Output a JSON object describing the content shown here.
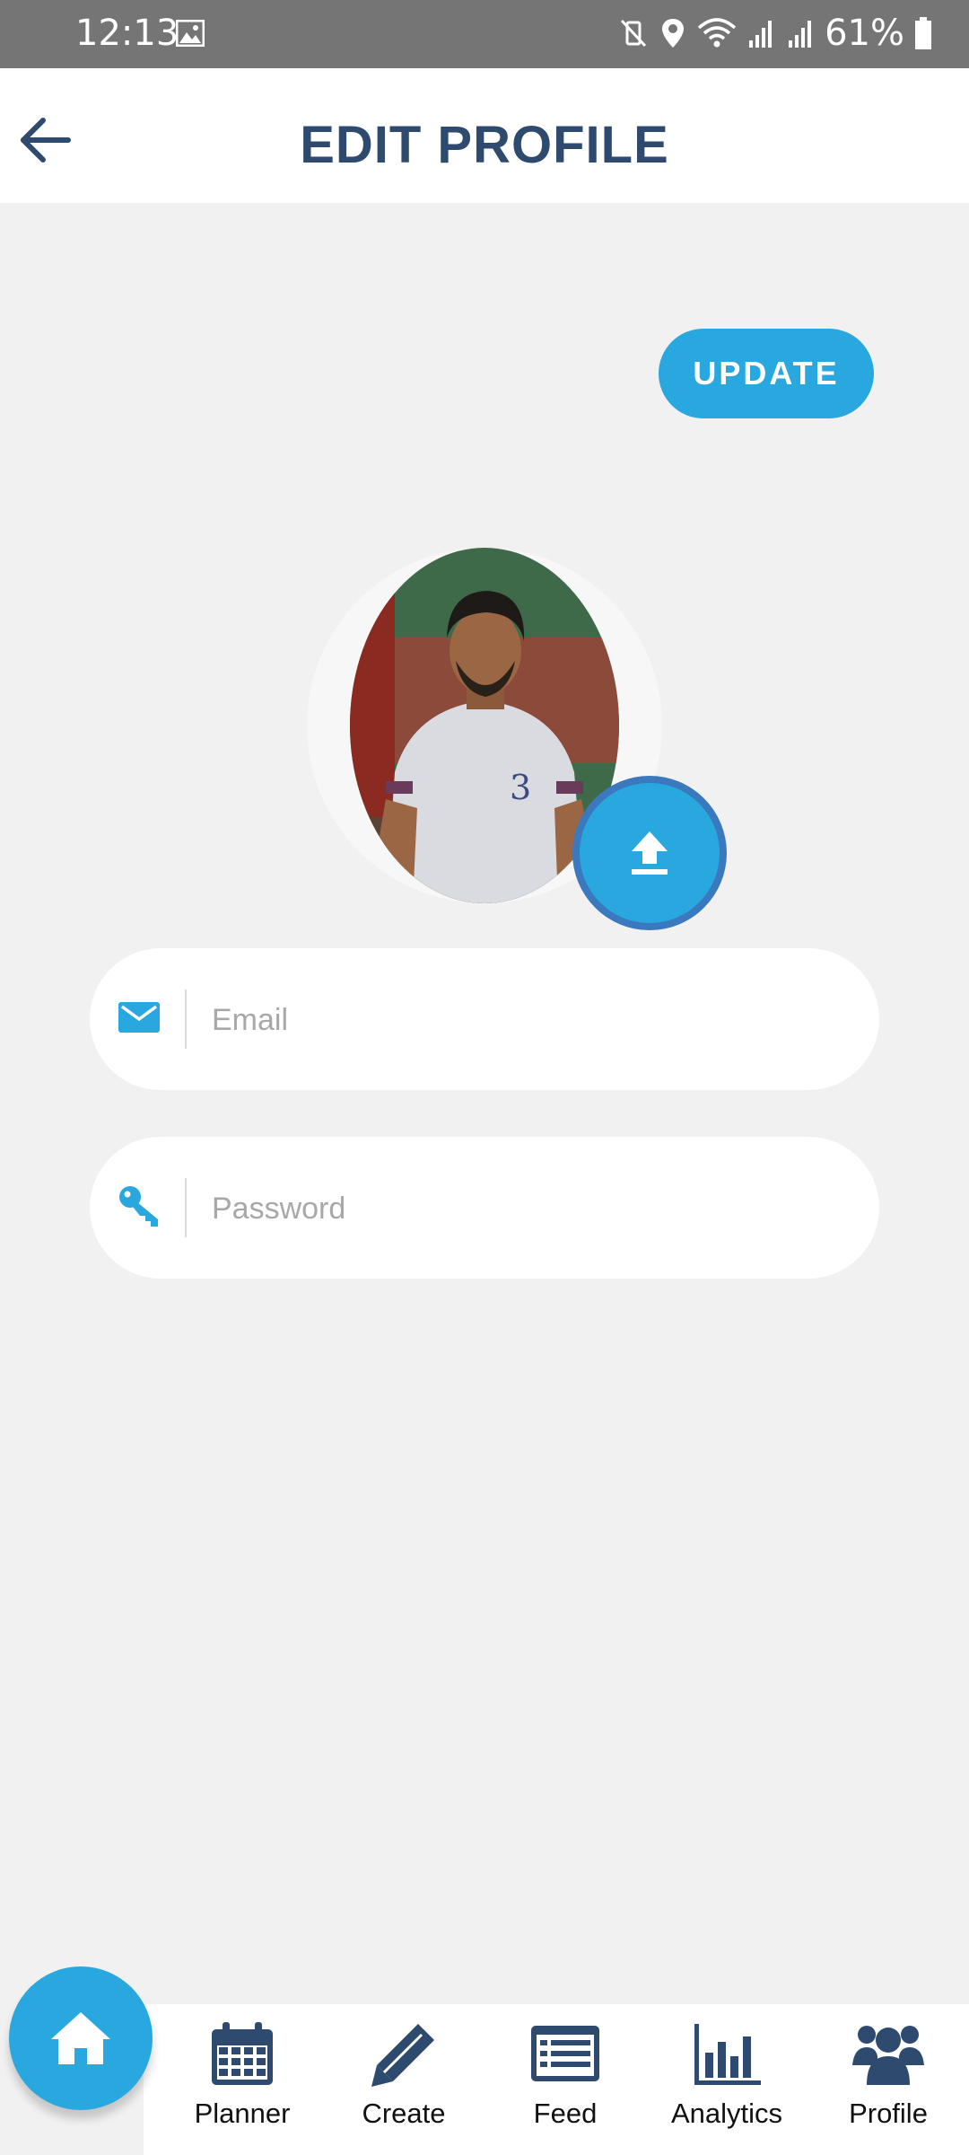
{
  "status_bar": {
    "time": "12:13",
    "battery": "61%",
    "icons": [
      "gallery-icon",
      "mute-vibrate-icon",
      "location-icon",
      "wifi-icon",
      "signal-icon",
      "signal-icon",
      "battery-icon"
    ]
  },
  "header": {
    "title": "EDIT PROFILE",
    "back_icon": "arrow-left-icon"
  },
  "actions": {
    "update_label": "UPDATE"
  },
  "avatar": {
    "upload_icon": "upload-icon"
  },
  "form": {
    "email": {
      "placeholder": "Email",
      "value": "",
      "icon": "mail-icon"
    },
    "password": {
      "placeholder": "Password",
      "value": "",
      "icon": "key-icon"
    }
  },
  "bottom_nav": {
    "home_icon": "home-icon",
    "items": [
      {
        "label": "Planner",
        "icon": "calendar-icon"
      },
      {
        "label": "Create",
        "icon": "pencil-icon"
      },
      {
        "label": "Feed",
        "icon": "feed-icon"
      },
      {
        "label": "Analytics",
        "icon": "bar-chart-icon"
      },
      {
        "label": "Profile",
        "icon": "users-icon"
      }
    ]
  },
  "colors": {
    "accent": "#29a8e0",
    "title": "#2f4a6f",
    "nav_icon": "#2f4a6f",
    "background": "#f1f1f1",
    "status_bar": "#757575"
  }
}
